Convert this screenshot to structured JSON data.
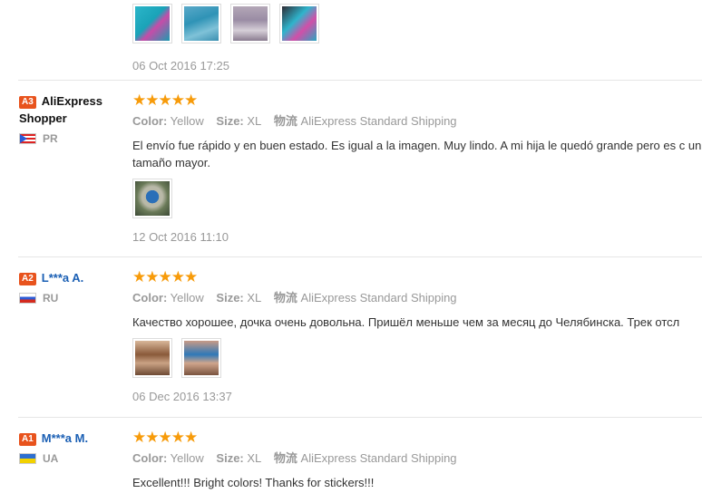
{
  "reviews": [
    {
      "date": "06 Oct 2016 17:25"
    },
    {
      "badge": "A3",
      "user": "AliExpress Shopper",
      "country": "PR",
      "stars": "★★★★★",
      "color_label": "Color:",
      "color_value": "Yellow",
      "size_label": "Size:",
      "size_value": "XL",
      "ship_label": "物流",
      "ship_value": "AliExpress Standard Shipping",
      "text": "El envío fue rápido y en buen estado. Es igual a la imagen. Muy lindo. A mi hija le quedó grande pero es c un tamaño mayor.",
      "date": "12 Oct 2016 11:10"
    },
    {
      "badge": "A2",
      "user": "L***a A.",
      "country": "RU",
      "stars": "★★★★★",
      "color_label": "Color:",
      "color_value": "Yellow",
      "size_label": "Size:",
      "size_value": "XL",
      "ship_label": "物流",
      "ship_value": "AliExpress Standard Shipping",
      "text": "Качество хорошее, дочка очень довольна. Пришёл меньше чем за месяц до Челябинска. Трек отсл",
      "date": "06 Dec 2016 13:37"
    },
    {
      "badge": "A1",
      "user": "M***a M.",
      "country": "UA",
      "stars": "★★★★★",
      "color_label": "Color:",
      "color_value": "Yellow",
      "size_label": "Size:",
      "size_value": "XL",
      "ship_label": "物流",
      "ship_value": "AliExpress Standard Shipping",
      "text": "Excellent!!! Bright colors! Thanks for stickers!!!"
    }
  ]
}
